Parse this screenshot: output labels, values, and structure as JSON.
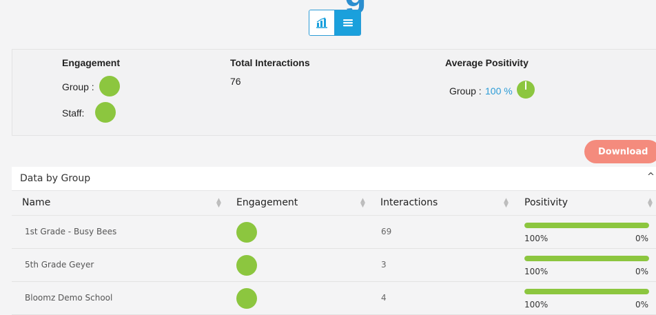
{
  "header": {
    "title_fragment": "g"
  },
  "view_toggle": {
    "chart_icon": "bar-chart-icon",
    "list_icon": "list-icon"
  },
  "summary": {
    "engagement_heading": "Engagement",
    "group_label": "Group :",
    "staff_label": "Staff:",
    "total_heading": "Total Interactions",
    "total_value": "76",
    "positivity_heading": "Average Positivity",
    "positivity_group_label": "Group :",
    "positivity_value": "100 %",
    "positivity_fraction": 1.0
  },
  "actions": {
    "download_label": "Download"
  },
  "table": {
    "title": "Data by Group",
    "columns": [
      "Name",
      "Engagement",
      "Interactions",
      "Positivity"
    ],
    "rows": [
      {
        "name": "1st Grade - Busy Bees",
        "interactions": "69",
        "positive": "100%",
        "negative": "0%",
        "positive_fraction": 1.0
      },
      {
        "name": "5th Grade Geyer",
        "interactions": "3",
        "positive": "100%",
        "negative": "0%",
        "positive_fraction": 1.0
      },
      {
        "name": "Bloomz Demo School",
        "interactions": "4",
        "positive": "100%",
        "negative": "0%",
        "positive_fraction": 1.0
      }
    ]
  },
  "colors": {
    "engagement_green": "#8cc63f",
    "accent_blue": "#1aa0dc",
    "download_coral": "#f48b7d"
  }
}
